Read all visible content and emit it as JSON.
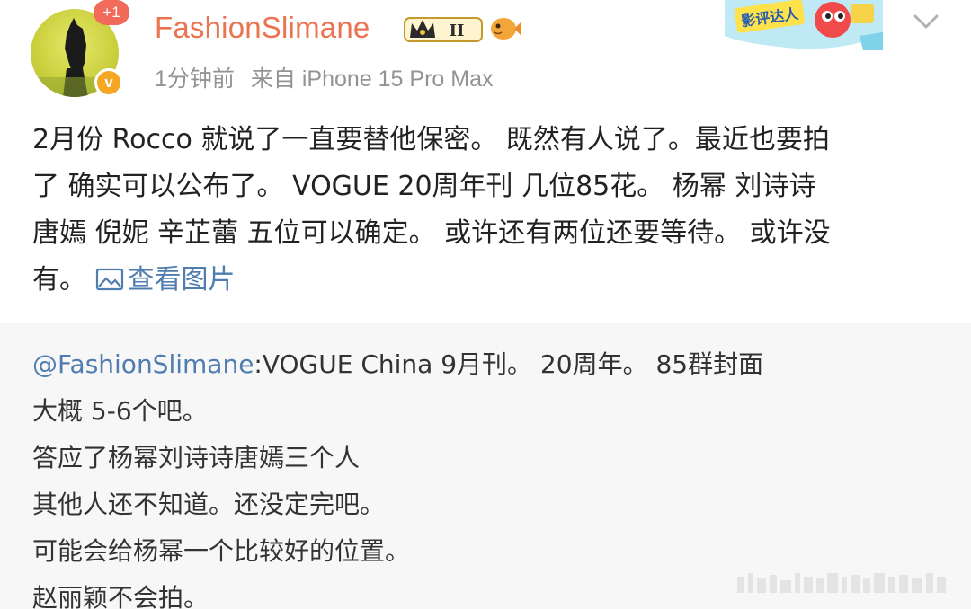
{
  "post": {
    "badge_count": "+1",
    "verify_mark": "v",
    "username": "FashionSlimane",
    "rank_badge": "II",
    "time": "1分钟前",
    "source": "来自 iPhone 15 Pro Max",
    "promo_label": "影评达人",
    "text_lines": [
      "2月份 Rocco 就说了一直要替他保密。 既然有人说了。最近也要拍",
      "了 确实可以公布了。 VOGUE 20周年刊 几位85花。 杨幂 刘诗诗",
      "唐嫣 倪妮 辛芷蕾 五位可以确定。 或许还有两位还要等待。 或许没",
      "有。 "
    ],
    "view_image_label": "查看图片"
  },
  "repost": {
    "mention": "@FashionSlimane",
    "first_line": ":VOGUE China 9月刊。 20周年。 85群封面",
    "lines": [
      "大概 5-6个吧。",
      "答应了杨幂刘诗诗唐嫣三个人",
      "其他人还不知道。还没定完吧。",
      "可能会给杨幂一个比较好的位置。",
      "赵丽颖不会拍。"
    ]
  },
  "colors": {
    "username": "#eb7350",
    "link": "#507daf",
    "meta": "#939393",
    "repost_bg": "#f7f7f7"
  }
}
